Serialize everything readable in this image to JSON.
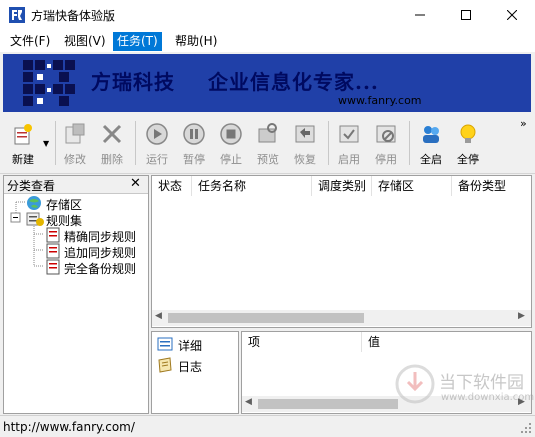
{
  "window": {
    "title": "方瑞快备体验版",
    "controls": [
      "minimize-icon",
      "maximize-icon",
      "close-icon"
    ]
  },
  "menu": {
    "items": [
      {
        "label": "文件(F)"
      },
      {
        "label": "视图(V)"
      },
      {
        "label": "任务(T)",
        "active": true
      },
      {
        "label": "帮助(H)"
      }
    ]
  },
  "banner": {
    "company": "方瑞科技",
    "slogan": "企业信息化专家...",
    "url": "www.fanry.com",
    "background": "#2040a8"
  },
  "toolbar": {
    "buttons": [
      {
        "label": "新建",
        "icon": "new-icon",
        "enabled": true,
        "has_dropdown": true
      },
      {
        "label": "修改",
        "icon": "edit-icon",
        "enabled": false
      },
      {
        "label": "删除",
        "icon": "delete-icon",
        "enabled": false
      },
      {
        "label": "运行",
        "icon": "run-icon",
        "enabled": false
      },
      {
        "label": "暂停",
        "icon": "pause-icon",
        "enabled": false
      },
      {
        "label": "停止",
        "icon": "stop-icon",
        "enabled": false
      },
      {
        "label": "预览",
        "icon": "preview-icon",
        "enabled": false
      },
      {
        "label": "恢复",
        "icon": "restore-icon",
        "enabled": false
      },
      {
        "label": "启用",
        "icon": "enable-icon",
        "enabled": false
      },
      {
        "label": "停用",
        "icon": "disable-icon",
        "enabled": false
      },
      {
        "label": "全启",
        "icon": "enable-all-icon",
        "enabled": true
      },
      {
        "label": "全停",
        "icon": "stop-all-icon",
        "enabled": true
      }
    ],
    "overflow": "»"
  },
  "category_panel": {
    "title": "分类查看",
    "close": "✕",
    "tree": {
      "storage": "存储区",
      "rule_set": "规则集",
      "rules": [
        "精确同步规则",
        "追加同步规则",
        "完全备份规则"
      ]
    }
  },
  "task_list": {
    "columns": [
      "状态",
      "任务名称",
      "调度类别",
      "存储区",
      "备份类型"
    ],
    "rows": []
  },
  "detail_nav": {
    "items": [
      {
        "label": "详细",
        "icon": "details-icon"
      },
      {
        "label": "日志",
        "icon": "log-icon"
      }
    ]
  },
  "detail_grid": {
    "columns": [
      "项",
      "值"
    ]
  },
  "statusbar": {
    "text": "http://www.fanry.com/"
  },
  "watermark": {
    "cn": "当下软件园",
    "url": "www.downxia.com"
  },
  "colors": {
    "accent": "#0078d7",
    "banner": "#2040a8",
    "banner_text": "#000a60"
  }
}
